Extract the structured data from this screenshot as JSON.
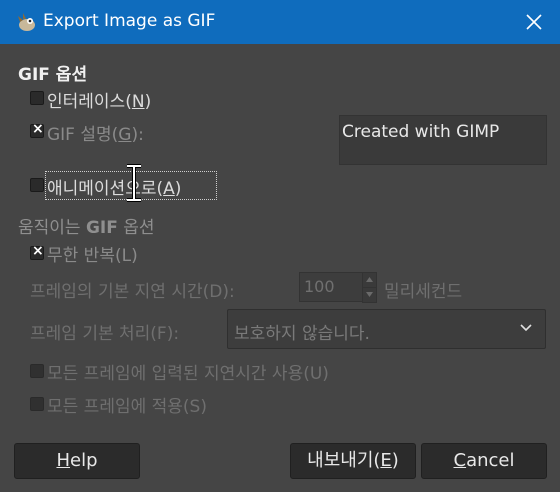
{
  "window": {
    "title": "Export Image as GIF",
    "app_icon": "gimp-wilber-icon",
    "accent_color": "#0f6cbd"
  },
  "gif_options": {
    "heading": "GIF 옵션",
    "interlace": {
      "pre": "인터레이스(",
      "key": "N",
      "post": ")",
      "checked": false
    },
    "comment": {
      "pre": "GIF 설명(",
      "key": "G",
      "post": "):",
      "checked": true,
      "value": "Created with GIMP"
    },
    "as_animation": {
      "pre": "애니메이션으로(",
      "key": "A",
      "post": ")",
      "checked": false
    }
  },
  "animated_options": {
    "heading_pre": "움직이는 ",
    "heading_bold": "GIF",
    "heading_post": " 옵션",
    "loop_forever": {
      "label": "무한 반복(L)",
      "checked": true
    },
    "default_delay": {
      "label": "프레임의 기본 지연 시간(D):",
      "value": "100",
      "unit": "밀리세컨드"
    },
    "frame_disposal": {
      "label": "프레임 기본 처리(F):",
      "value": "보호하지 않습니다."
    },
    "use_delay": {
      "label": "모든 프레임에 입력된 지연시간 사용(U)",
      "checked": false
    },
    "use_disposal": {
      "label": "모든 프레임에 적용(S)",
      "checked": false
    }
  },
  "buttons": {
    "help": {
      "key": "H",
      "rest": "elp"
    },
    "export": {
      "pre": "내보내기(",
      "key": "E",
      "post": ")"
    },
    "cancel": {
      "key": "C",
      "rest": "ancel"
    }
  }
}
